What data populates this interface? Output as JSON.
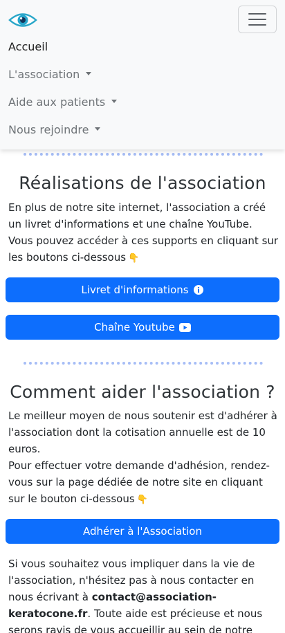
{
  "nav": {
    "logo_alt": "Association Kératocône logo",
    "items": [
      {
        "label": "Accueil",
        "dropdown": false
      },
      {
        "label": "L'association",
        "dropdown": true
      },
      {
        "label": "Aide aux patients",
        "dropdown": true
      },
      {
        "label": "Nous rejoindre",
        "dropdown": true
      }
    ],
    "toggler_icon": "hamburger-icon"
  },
  "realisations": {
    "title": "Réalisations de l'association",
    "text": "En plus de notre site internet, l'association a créé un livret d'informations et une chaîne YouTube. Vous pouvez accéder à ces supports en cliquant sur les boutons ci-dessous",
    "emoji": "👇",
    "buttons": [
      {
        "label": "Livret d'informations",
        "icon": "info-circle-icon"
      },
      {
        "label": "Chaîne Youtube",
        "icon": "youtube-icon"
      }
    ]
  },
  "aider": {
    "title": "Comment aider l'association ?",
    "text1": "Le meilleur moyen de nous soutenir est d'adhérer à l'association dont la cotisation annuelle est de 10 euros.",
    "text2": "Pour effectuer votre demande d'adhésion, rendez-vous sur la page dédiée de notre site en cliquant sur le bouton ci-dessous",
    "emoji": "👇",
    "button_label": "Adhérer à l'Association",
    "text3_before": "Si vous souhaitez vous impliquer dans la vie de l'association, n'hésitez pas à nous contacter en nous écrivant à ",
    "email": "contact@association-keratocone.fr",
    "text3_after": ". Toute aide est précieuse et nous serons ravis de vous accueillir au sein de notre"
  },
  "colors": {
    "primary": "#0d6efd",
    "navbar_bg": "#f8f9fa",
    "divider": "#a6bdf6"
  }
}
